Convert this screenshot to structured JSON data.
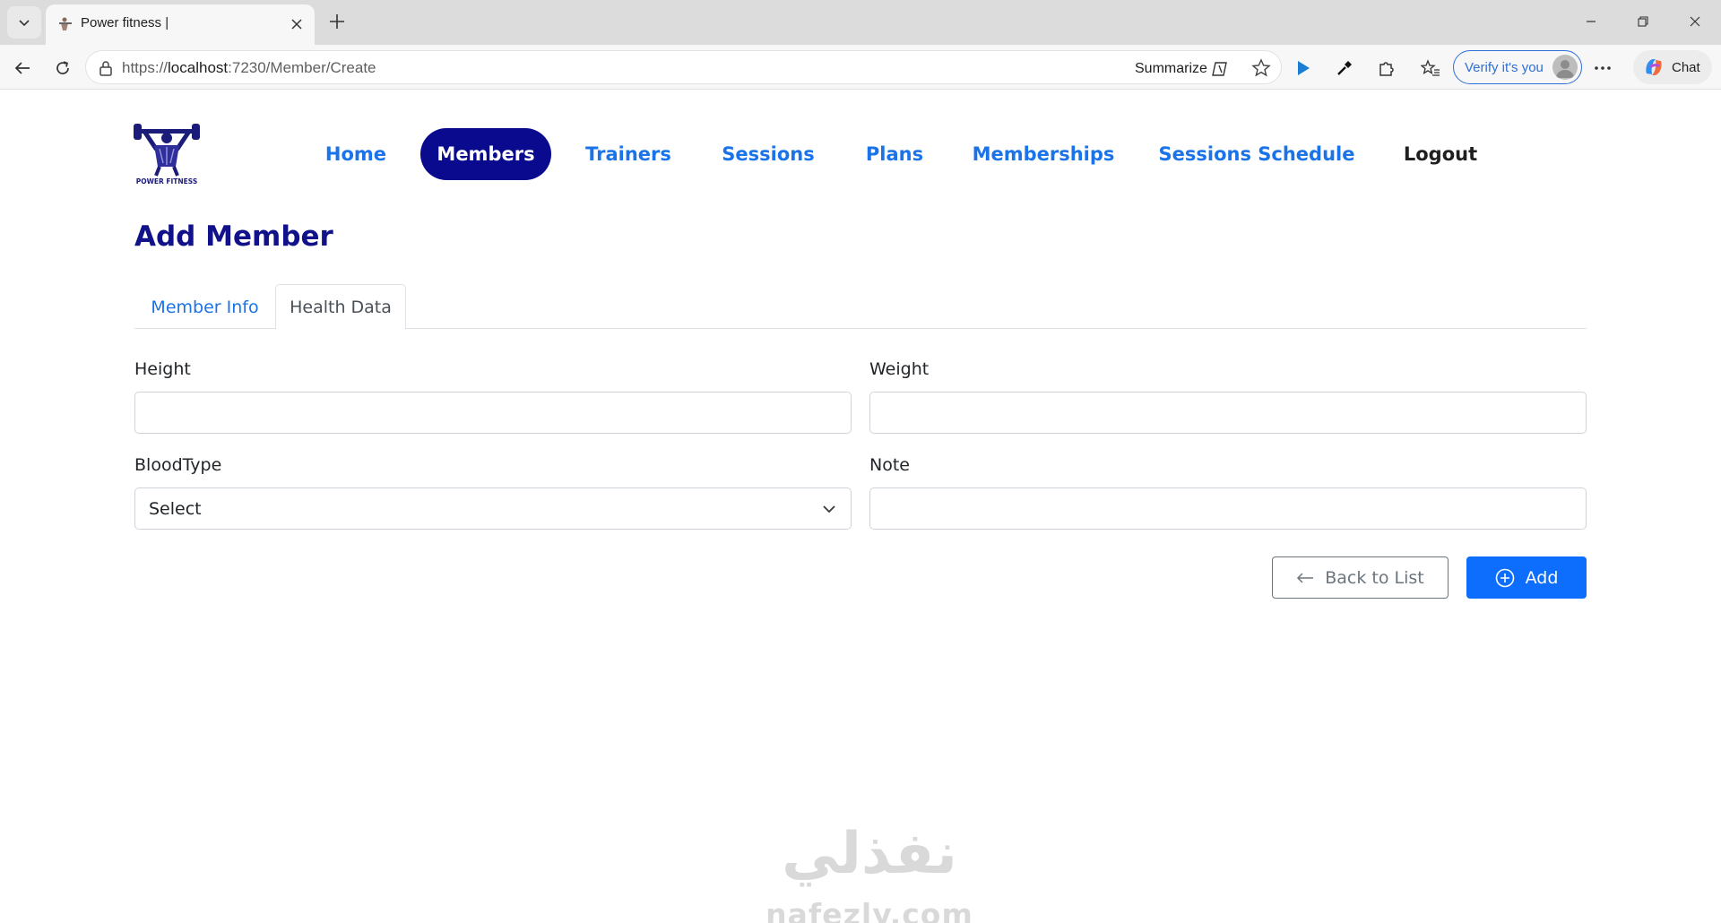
{
  "browser": {
    "tab_title": "Power fitness |",
    "url_scheme": "https://",
    "url_host": "localhost",
    "url_path": ":7230/Member/Create",
    "summarize_label": "Summarize",
    "verify_label": "Verify it's you",
    "chat_label": "Chat"
  },
  "logo": {
    "text": "POWER FITNESS"
  },
  "nav": {
    "items": [
      {
        "label": "Home",
        "active": false
      },
      {
        "label": "Members",
        "active": true
      },
      {
        "label": "Trainers",
        "active": false
      },
      {
        "label": "Sessions",
        "active": false
      },
      {
        "label": "Plans",
        "active": false
      },
      {
        "label": "Memberships",
        "active": false
      },
      {
        "label": "Sessions Schedule",
        "active": false
      }
    ],
    "logout_label": "Logout"
  },
  "page": {
    "title": "Add Member"
  },
  "form_tabs": [
    {
      "label": "Member Info",
      "active": false
    },
    {
      "label": "Health Data",
      "active": true
    }
  ],
  "form": {
    "height_label": "Height",
    "height_value": "",
    "weight_label": "Weight",
    "weight_value": "",
    "bloodtype_label": "BloodType",
    "bloodtype_selected": "Select",
    "note_label": "Note",
    "note_value": ""
  },
  "actions": {
    "back_label": "Back to List",
    "add_label": "Add"
  },
  "watermark": {
    "arabic": "نفذلي",
    "url": "nafezly.com"
  },
  "colors": {
    "nav_link": "#1a73e8",
    "nav_active_bg": "#0a0a8f",
    "title": "#11118a",
    "primary_button": "#0d6efd"
  }
}
